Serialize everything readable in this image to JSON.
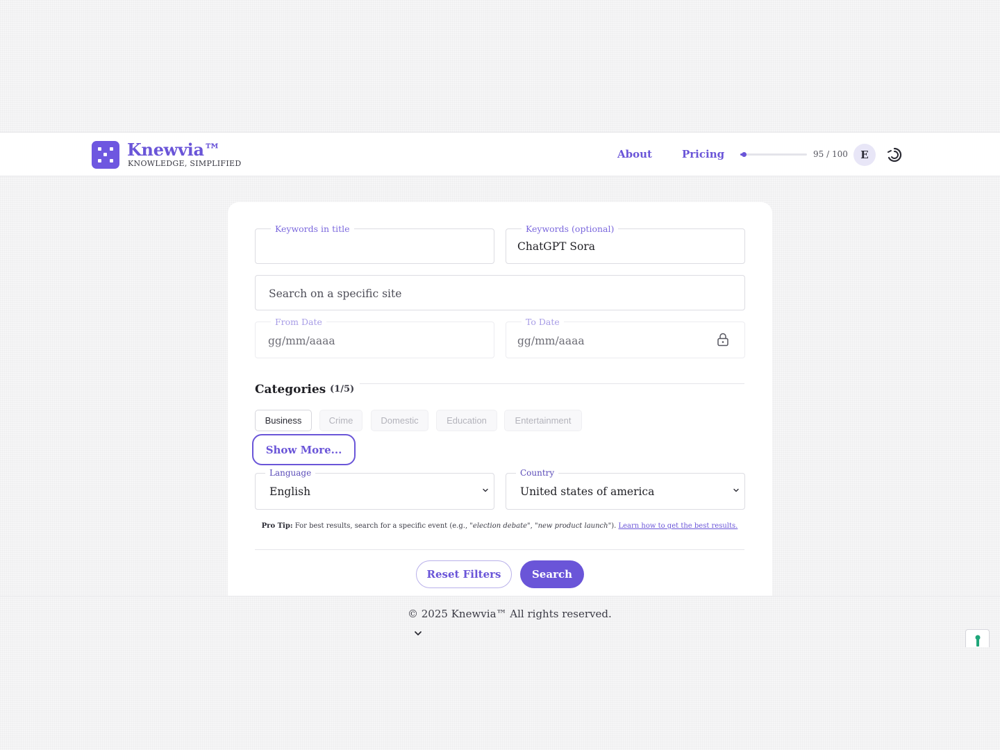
{
  "brand": {
    "name": "Knewvia™",
    "tagline": "KNOWLEDGE, SIMPLIFIED",
    "color": "#6a55d8"
  },
  "nav": {
    "about": "About",
    "pricing": "Pricing"
  },
  "usage": {
    "text": "95 / 100",
    "remaining_fraction": 0.05
  },
  "user": {
    "initial": "E"
  },
  "form": {
    "keywords_title": {
      "label": "Keywords in title",
      "value": ""
    },
    "keywords_optional": {
      "label": "Keywords (optional)",
      "value": "ChatGPT Sora"
    },
    "site": {
      "placeholder": "Search on a specific site"
    },
    "from_date": {
      "label": "From Date",
      "placeholder": "gg/mm/aaaa"
    },
    "to_date": {
      "label": "To Date",
      "placeholder": "gg/mm/aaaa",
      "locked": true
    },
    "categories": {
      "title": "Categories",
      "count": "(1/5)",
      "items": [
        {
          "label": "Business",
          "selected": true
        },
        {
          "label": "Crime",
          "selected": false
        },
        {
          "label": "Domestic",
          "selected": false
        },
        {
          "label": "Education",
          "selected": false
        },
        {
          "label": "Entertainment",
          "selected": false
        }
      ],
      "show_more": "Show More..."
    },
    "language": {
      "label": "Language",
      "value": "English"
    },
    "country": {
      "label": "Country",
      "value": "United states of america"
    },
    "tip": {
      "prefix": "Pro Tip:",
      "text": " For best results, search for a specific event (e.g., ",
      "example1": "\"election debate\"",
      "sep": ", ",
      "example2": "\"new product launch\"",
      "close": "). ",
      "link": "Learn how to get the best results."
    },
    "reset_label": "Reset Filters",
    "search_label": "Search"
  },
  "footer": {
    "copyright": "© 2025 Knewvia™ All rights reserved."
  }
}
